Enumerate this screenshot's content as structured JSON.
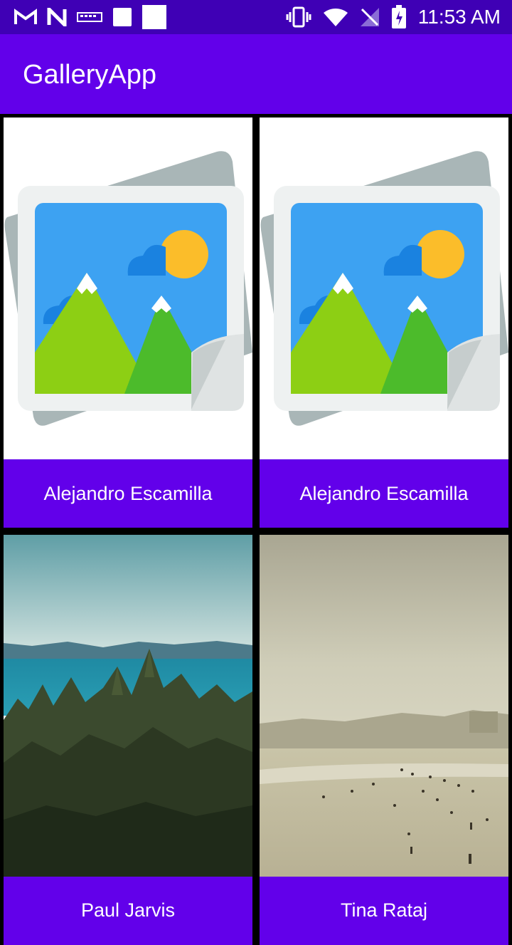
{
  "status_bar": {
    "time": "11:53 AM",
    "left_icons": [
      "gmail-icon",
      "n-app-icon",
      "keyboard-icon",
      "square-icon",
      "square-icon"
    ],
    "right_icons": [
      "vibrate-icon",
      "wifi-icon",
      "no-signal-icon",
      "battery-charging-icon"
    ]
  },
  "app_bar": {
    "title": "GalleryApp"
  },
  "colors": {
    "primary": "#6200ea",
    "primary_dark": "#3f00b5",
    "background": "#000000"
  },
  "gallery": {
    "items": [
      {
        "author": "Alejandro Escamilla",
        "image": "placeholder-image-icon"
      },
      {
        "author": "Alejandro Escamilla",
        "image": "placeholder-image-icon"
      },
      {
        "author": "Paul Jarvis",
        "image": "forest-ocean-photo"
      },
      {
        "author": "Tina Rataj",
        "image": "beach-photo"
      }
    ]
  }
}
